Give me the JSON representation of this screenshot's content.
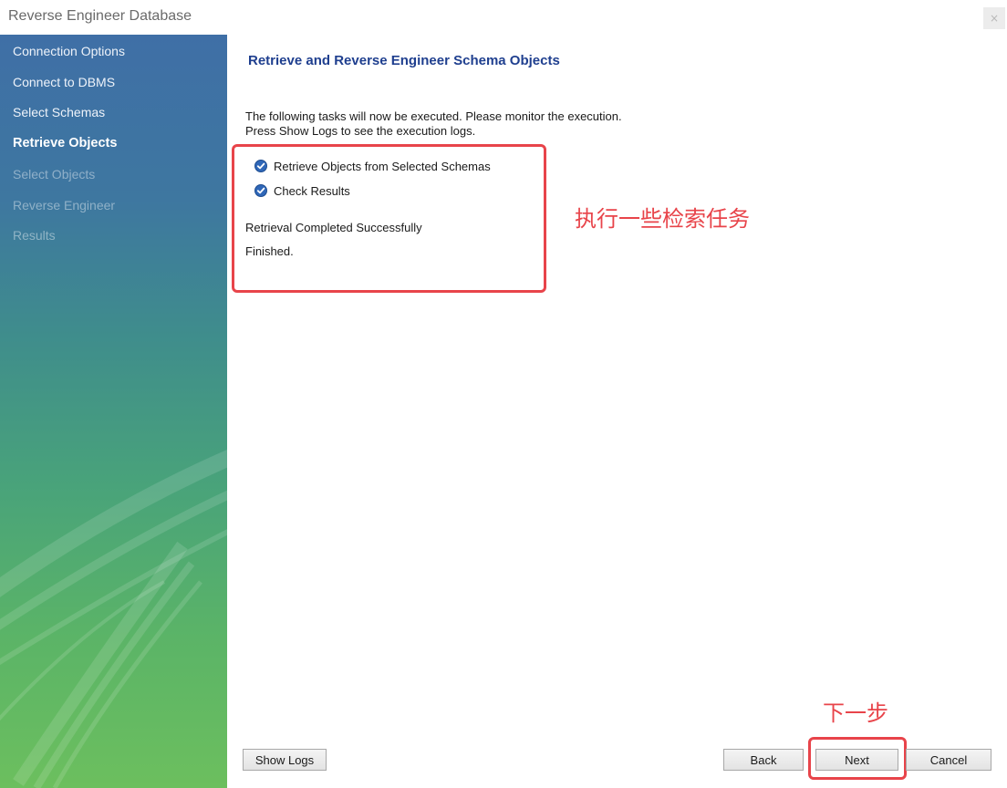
{
  "window": {
    "title": "Reverse Engineer Database",
    "close_glyph": "×"
  },
  "sidebar": {
    "items": [
      {
        "label": "Connection Options",
        "state": "done"
      },
      {
        "label": "Connect to DBMS",
        "state": "done"
      },
      {
        "label": "Select Schemas",
        "state": "done"
      },
      {
        "label": "Retrieve Objects",
        "state": "active"
      },
      {
        "label": "Select Objects",
        "state": "disabled"
      },
      {
        "label": "Reverse Engineer",
        "state": "disabled"
      },
      {
        "label": "Results",
        "state": "disabled"
      }
    ]
  },
  "main": {
    "heading": "Retrieve and Reverse Engineer Schema Objects",
    "description_line1": "The following tasks will now be executed. Please monitor the execution.",
    "description_line2": "Press Show Logs to see the execution logs.",
    "tasks": [
      {
        "label": "Retrieve Objects from Selected Schemas",
        "icon": "check-circle-icon",
        "done": true
      },
      {
        "label": "Check Results",
        "icon": "check-circle-icon",
        "done": true
      }
    ],
    "status_message": "Retrieval Completed Successfully",
    "finished_message": "Finished."
  },
  "annotations": {
    "tasks_note": "执行一些检索任务",
    "next_note": "下一步",
    "highlight_color": "#e8444a"
  },
  "buttons": {
    "show_logs": "Show Logs",
    "back": "Back",
    "next": "Next",
    "cancel": "Cancel"
  },
  "colors": {
    "heading": "#1f3f8f",
    "check_icon": "#2f67b8",
    "sidebar_top": "#3f6fa6",
    "sidebar_bottom": "#6cbf5e"
  }
}
